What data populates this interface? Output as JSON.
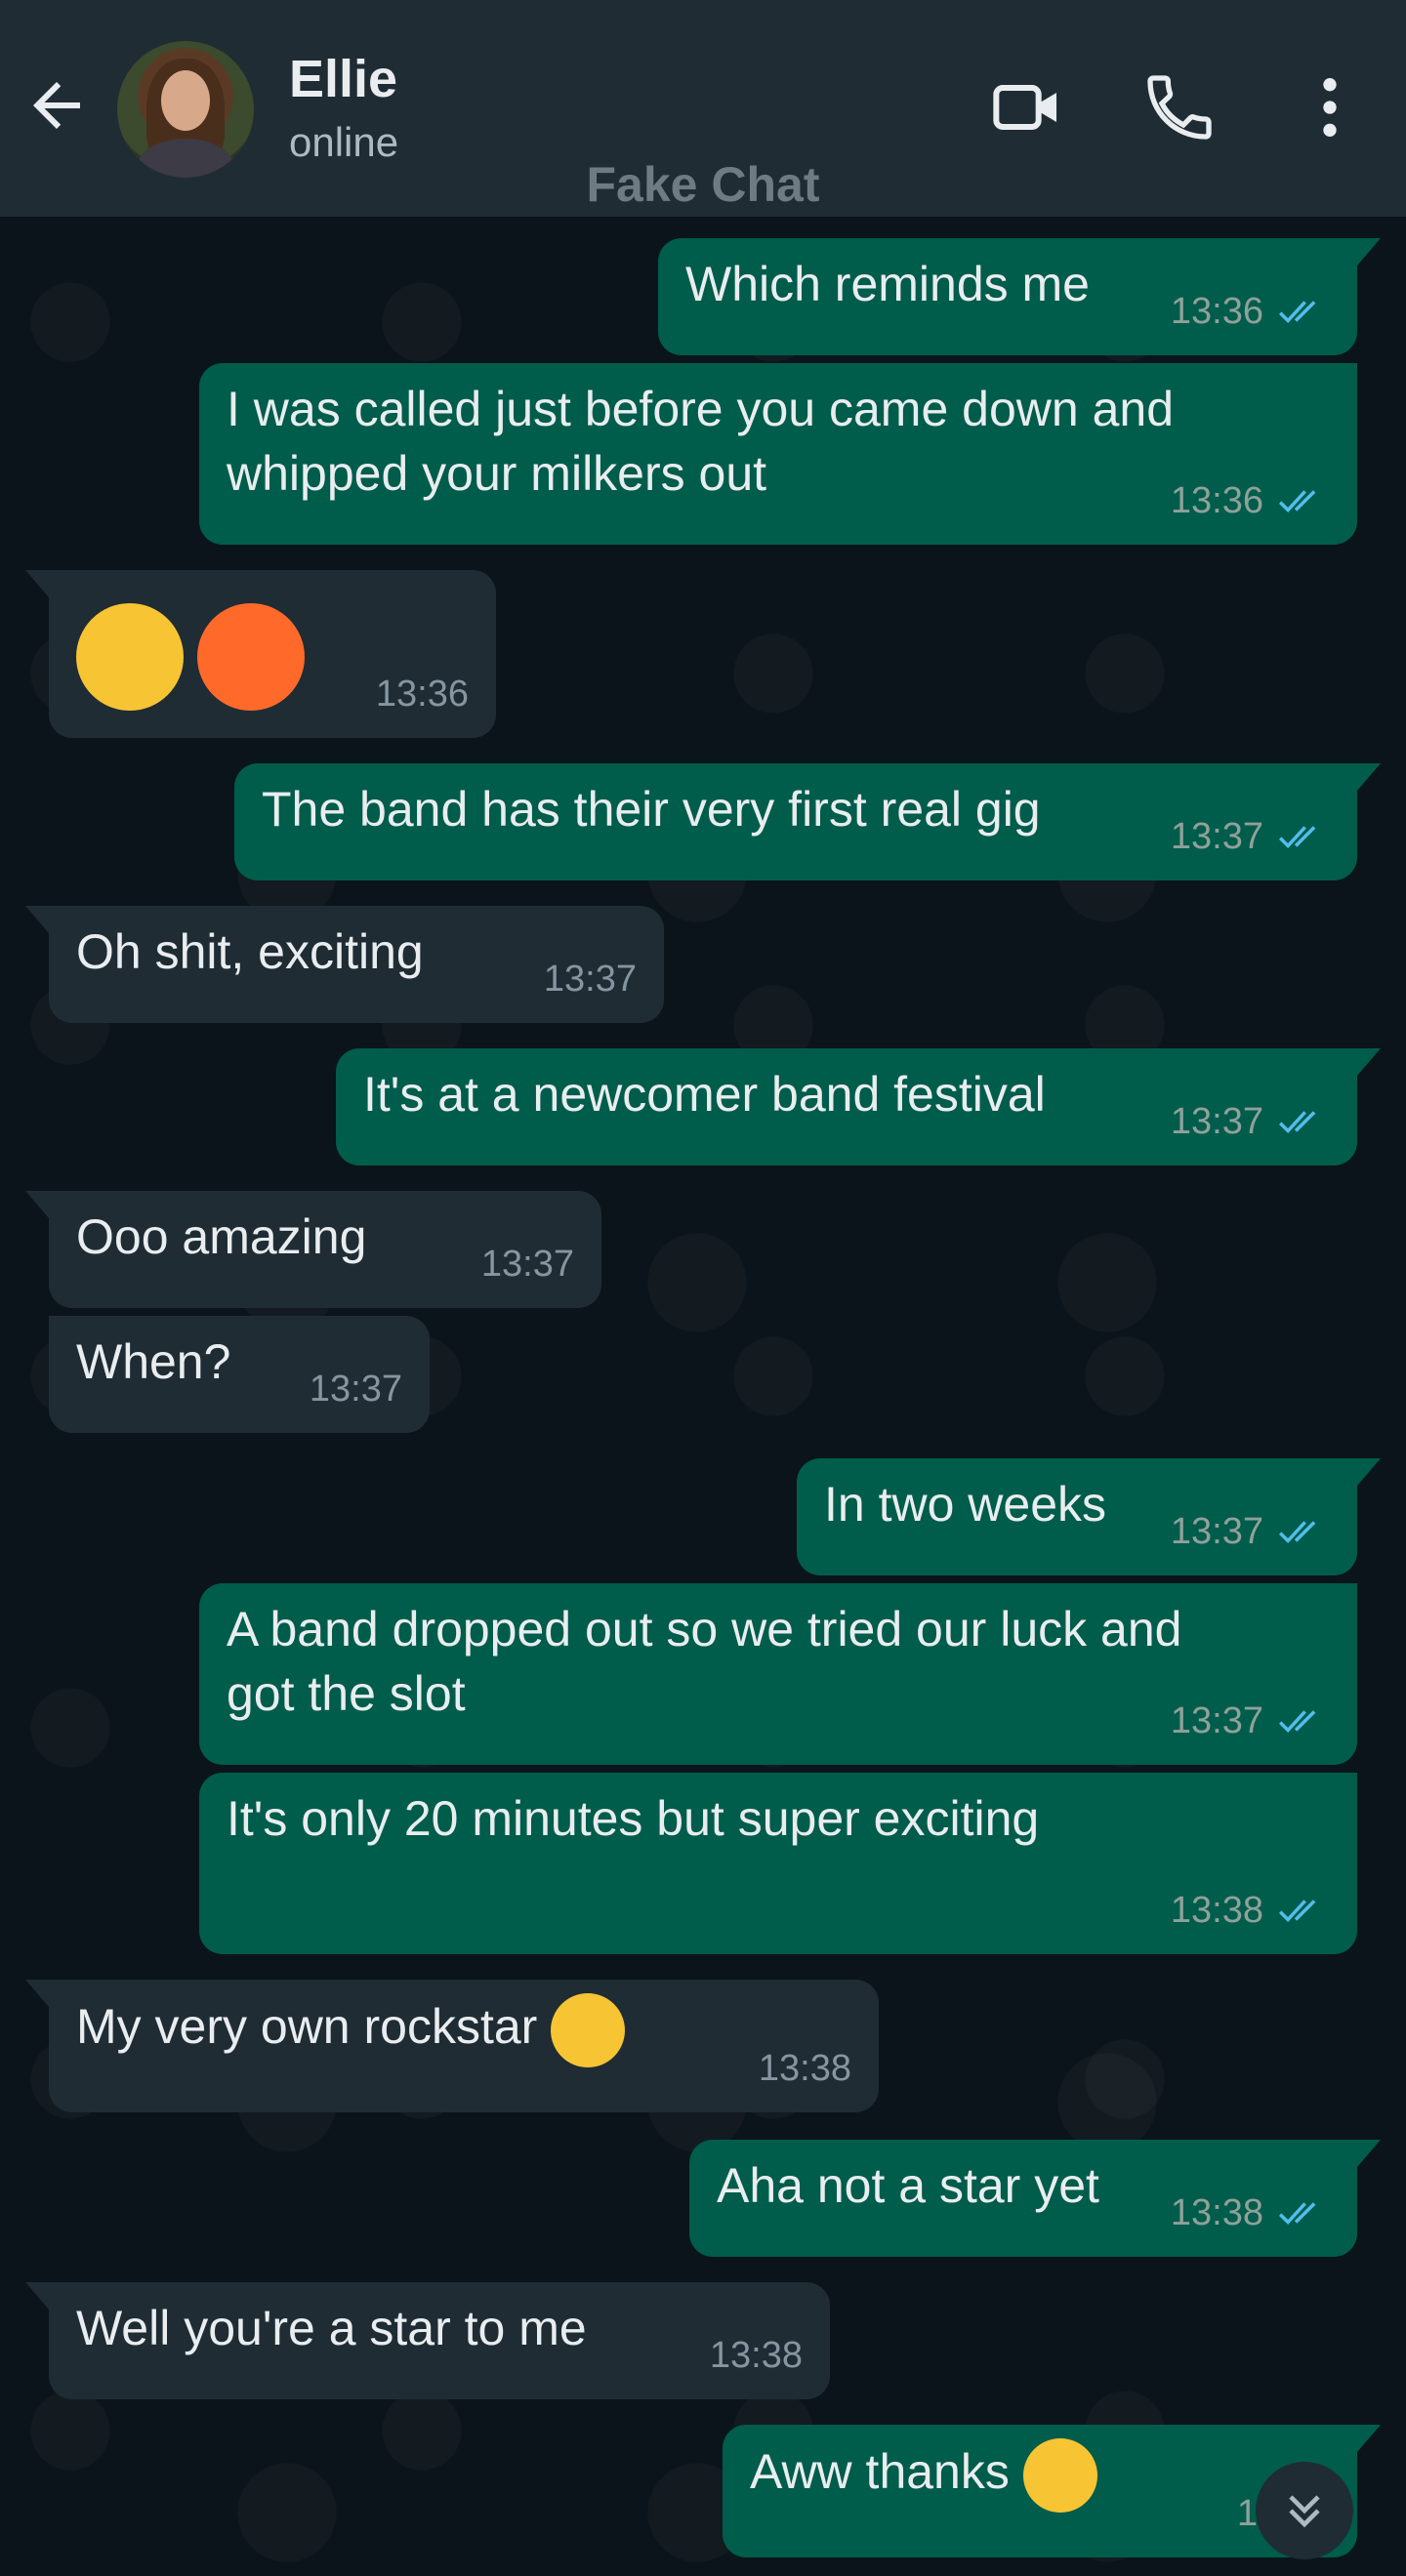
{
  "header": {
    "contact_name": "Ellie",
    "status": "online",
    "watermark": "Fake Chat",
    "icons": [
      "back-arrow-icon",
      "video-call-icon",
      "phone-icon",
      "more-vertical-icon"
    ]
  },
  "messages": [
    {
      "dir": "out",
      "text": "Which reminds me",
      "time": "13:36"
    },
    {
      "dir": "out",
      "text": "I was called just before you came down and\nwhipped your milkers out",
      "time": "13:36"
    },
    {
      "dir": "in",
      "text": "",
      "emojis": [
        "rolling-on-floor-laughing-emoji",
        "hot-face-emoji"
      ],
      "time": "13:36"
    },
    {
      "dir": "out",
      "text": "The band has their very first real gig",
      "time": "13:37"
    },
    {
      "dir": "in",
      "text": "Oh shit, exciting",
      "time": "13:37"
    },
    {
      "dir": "out",
      "text": "It's at a newcomer band festival",
      "time": "13:37"
    },
    {
      "dir": "in",
      "text": "Ooo amazing",
      "time": "13:37"
    },
    {
      "dir": "in",
      "text": "When?",
      "time": "13:37"
    },
    {
      "dir": "out",
      "text": "In two weeks",
      "time": "13:37"
    },
    {
      "dir": "out",
      "text": "A band dropped out so we tried our luck and\ngot the slot",
      "time": "13:37"
    },
    {
      "dir": "out",
      "text": "It's only 20 minutes but super exciting",
      "time": "13:38"
    },
    {
      "dir": "in",
      "text": "My very own rockstar",
      "emojis": [
        "heart-eyes-emoji"
      ],
      "time": "13:38"
    },
    {
      "dir": "out",
      "text": "Aha not a star yet",
      "time": "13:38"
    },
    {
      "dir": "in",
      "text": "Well you're a star to me",
      "time": "13:38"
    },
    {
      "dir": "out",
      "text": "Aww thanks",
      "emojis": [
        "kissing-heart-emoji"
      ],
      "time": "13:38"
    }
  ],
  "colors": {
    "header_bg": "#1f2c34",
    "chat_bg": "#0b141a",
    "outgoing_bubble": "#005c4b",
    "incoming_bubble": "#1f2c34",
    "read_ticks": "#53bdeb"
  }
}
